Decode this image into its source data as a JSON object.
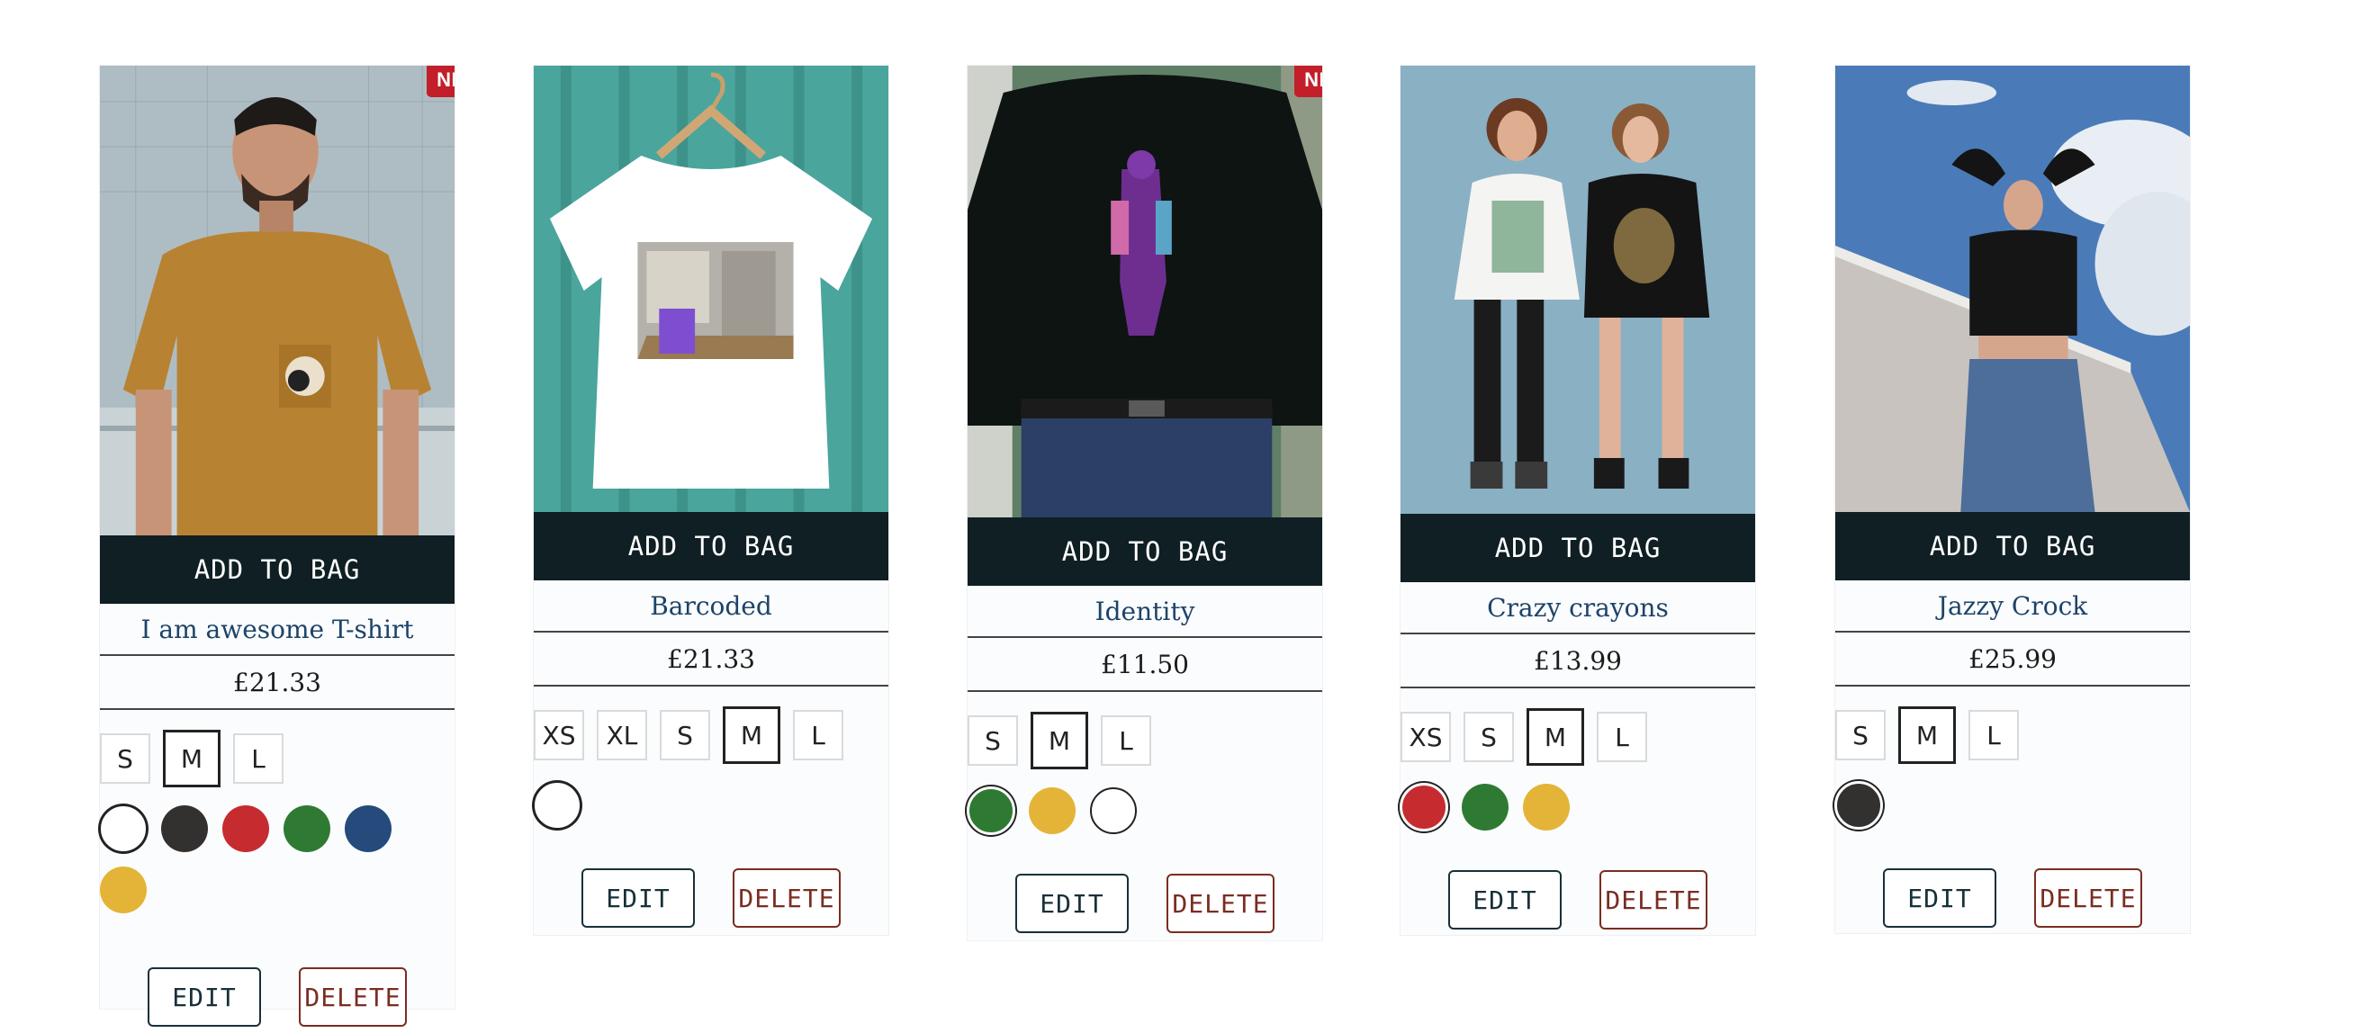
{
  "product_list": {
    "add_to_bag_label": "ADD TO BAG",
    "edit_label": "EDIT",
    "delete_label": "DELETE",
    "new_badge_label": "NEW",
    "colors": {
      "white": "#ffffff",
      "black": "#333030",
      "red": "#c62b2f",
      "green": "#2e7a32",
      "blue": "#254a7c",
      "yellow": "#e3b437",
      "bag_bar": "#0f1f23",
      "title_text": "#1d4369"
    },
    "products": [
      {
        "name": "I am awesome T-shirt",
        "price": "£21.33",
        "is_new": true,
        "sizes": [
          "S",
          "M",
          "L"
        ],
        "selected_size": "M",
        "colors": [
          "white",
          "black",
          "red",
          "green",
          "blue",
          "yellow"
        ],
        "selected_color": "white"
      },
      {
        "name": "Barcoded",
        "price": "£21.33",
        "is_new": false,
        "sizes": [
          "XS",
          "XL",
          "S",
          "M",
          "L"
        ],
        "selected_size": "M",
        "colors": [
          "white"
        ],
        "selected_color": "white"
      },
      {
        "name": "Identity",
        "price": "£11.50",
        "is_new": true,
        "sizes": [
          "S",
          "M",
          "L"
        ],
        "selected_size": "M",
        "colors": [
          "green",
          "yellow",
          "white"
        ],
        "selected_color": "green"
      },
      {
        "name": "Crazy crayons",
        "price": "£13.99",
        "is_new": false,
        "sizes": [
          "XS",
          "S",
          "M",
          "L"
        ],
        "selected_size": "M",
        "colors": [
          "red",
          "green",
          "yellow"
        ],
        "selected_color": "red"
      },
      {
        "name": "Jazzy Crock",
        "price": "£25.99",
        "is_new": false,
        "sizes": [
          "S",
          "M",
          "L"
        ],
        "selected_size": "M",
        "colors": [
          "black"
        ],
        "selected_color": "black"
      }
    ]
  }
}
